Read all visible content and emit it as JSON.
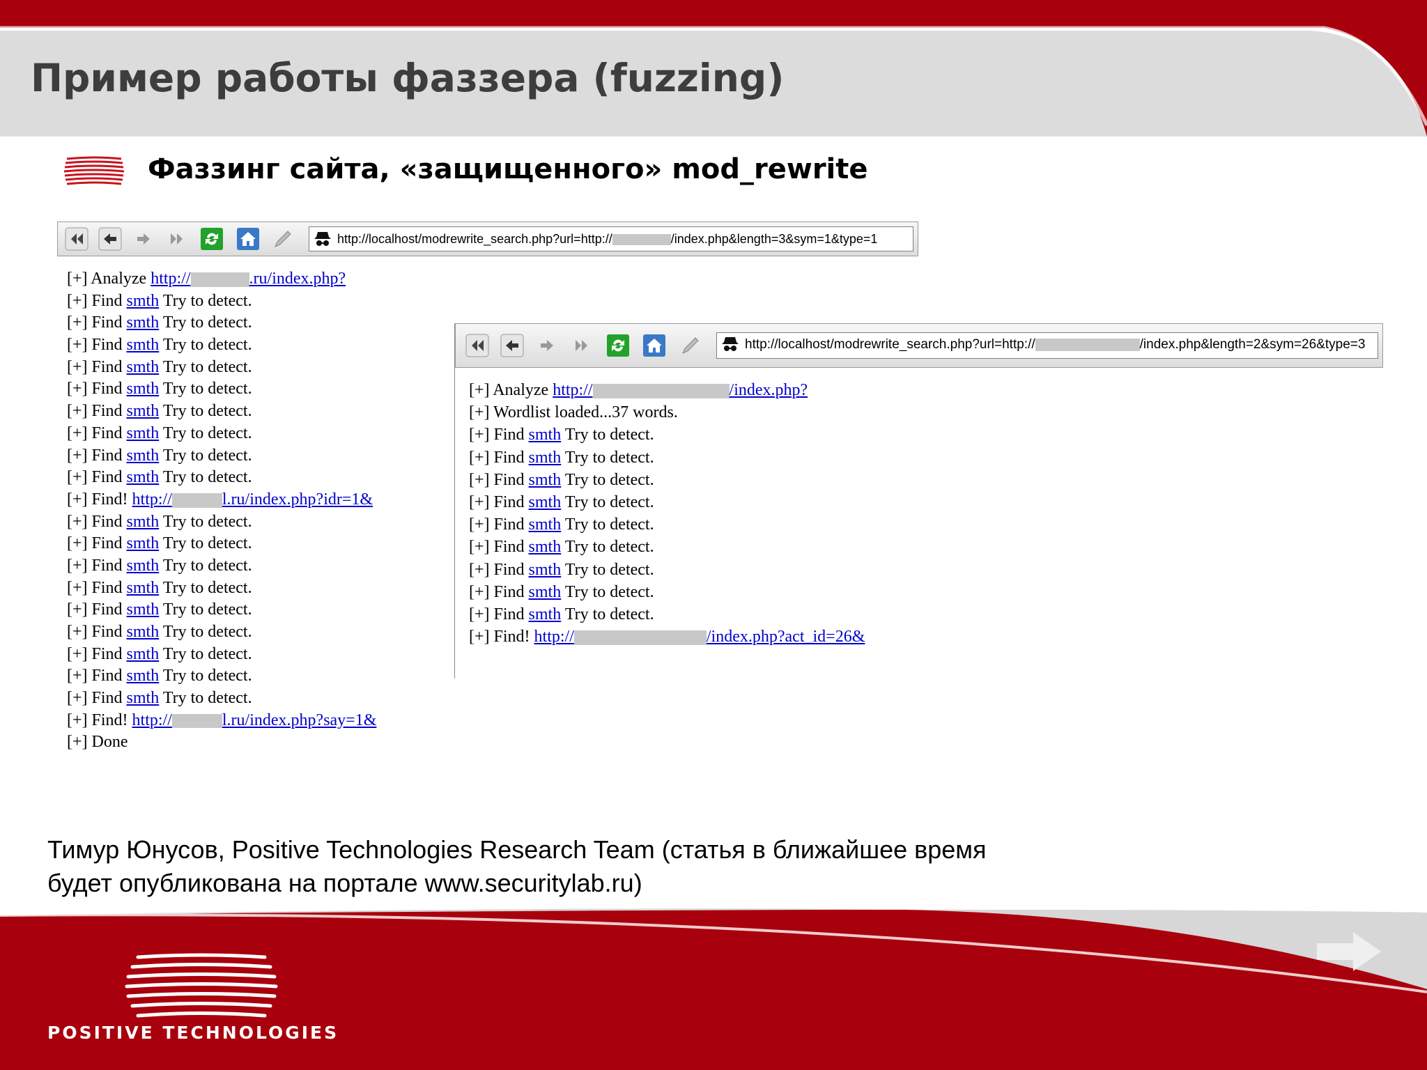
{
  "slide": {
    "title": "Пример работы фаззера (fuzzing)",
    "subtitle": "Фаззинг сайта, «защищенного» mod_rewrite",
    "footer_line1": "Тимур Юнусов, Positive Technologies Research Team (статья в ближайшее время",
    "footer_line2": "будет опубликована на портале www.securitylab.ru)",
    "logo_text": "POSITIVE TECHNOLOGIES"
  },
  "colors": {
    "brand_red": "#a8000c",
    "title_gray": "#3d3d3d",
    "link_blue": "#0000cc"
  },
  "window1": {
    "address_pre": "http://localhost/modrewrite_search.php?url=http://",
    "address_post": "/index.php&length=3&sym=1&type=1",
    "log": {
      "prefix": "[+]",
      "analyze_word": "Analyze",
      "analyze_link_pre": "http://",
      "analyze_link_post": ".ru/index.php?",
      "find_word": "Find",
      "smth": "smth",
      "try": "Try to detect.",
      "find_bang": "Find!",
      "found1_pre": "http://",
      "found1_post": "l.ru/index.php?idr=1&",
      "found2_pre": "http://",
      "found2_post": "l.ru/index.php?say=1&",
      "done": "Done"
    }
  },
  "window2": {
    "address_pre": "http://localhost/modrewrite_search.php?url=http://",
    "address_post": "/index.php&length=2&sym=26&type=3",
    "log": {
      "prefix": "[+]",
      "analyze_word": "Analyze",
      "analyze_link_pre": "http://",
      "analyze_link_post": "/index.php?",
      "wordlist": "Wordlist loaded...37 words.",
      "find_word": "Find",
      "smth": "smth",
      "try": "Try to detect.",
      "find_bang": "Find!",
      "found_pre": "http://",
      "found_post": "/index.php?act_id=26&"
    }
  },
  "icons": [
    "back-all-icon",
    "back-icon",
    "forward-icon",
    "forward-all-icon",
    "refresh-icon",
    "home-icon",
    "pencil-icon",
    "spy-icon",
    "next-slide-arrow-icon"
  ]
}
